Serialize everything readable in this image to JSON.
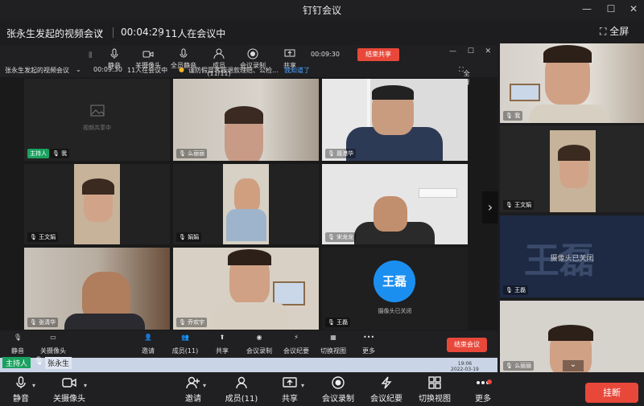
{
  "window": {
    "title": "钉钉会议",
    "controls": [
      "—",
      "☐",
      "✕"
    ]
  },
  "meeting": {
    "name": "张永生发起的视频会议",
    "duration": "00:04:29",
    "count": "11人在会议中",
    "fullscreen": "全屏"
  },
  "inner": {
    "toolbar": {
      "mute": "静音",
      "camera": "关摄像头",
      "mute_all": "全员静音",
      "members": "成员(11/11)",
      "record": "会议录制",
      "share": "共享"
    },
    "time": "00:09:30",
    "end_share": "结束共享",
    "name": "张永生发起的视频会议",
    "duration": "00:09:30",
    "count": "11人在会议中",
    "notice": "谨防假冒客服退款理赔、公检...",
    "notice_link": "我知道了",
    "fullscreen": "全屏",
    "tiles": [
      {
        "name": "我",
        "host": "主持人",
        "placeholder": "视频共享中"
      },
      {
        "name": "么丽丽"
      },
      {
        "name": "聂港华"
      },
      {
        "name": "王文娟"
      },
      {
        "name": "娟娟"
      },
      {
        "name": "宋龙龙"
      },
      {
        "name": "张清华"
      },
      {
        "name": "乔欢宇"
      },
      {
        "name": "王磊",
        "avatar": "王磊",
        "cam_off": "摄像头已关闭"
      }
    ],
    "bottom": {
      "mute": "静音",
      "camera": "关摄像头",
      "invite": "邀请",
      "members": "成员(11)",
      "share": "共享",
      "record": "会议录制",
      "minutes": "会议纪要",
      "switch": "切换视图",
      "more": "更多",
      "end": "结束会议"
    },
    "host_badge": "主持人",
    "host_name": "张永生",
    "clock_time": "19:06",
    "clock_date": "2022-03-19"
  },
  "side": [
    {
      "name": "我"
    },
    {
      "name": "王文娟"
    },
    {
      "name": "王磊",
      "avatar": "王磊",
      "cam_off": "摄像头已关闭"
    },
    {
      "name": "么丽丽"
    }
  ],
  "bottombar": {
    "mute": "静音",
    "camera": "关摄像头",
    "invite": "邀请",
    "members": "成员(11)",
    "share": "共享",
    "record": "会议录制",
    "minutes": "会议纪要",
    "switch": "切换视图",
    "more": "更多",
    "hangup": "挂断"
  },
  "colors": {
    "accent": "#e8483a",
    "host": "#19a15f",
    "avatar": "#1b8ff0"
  }
}
